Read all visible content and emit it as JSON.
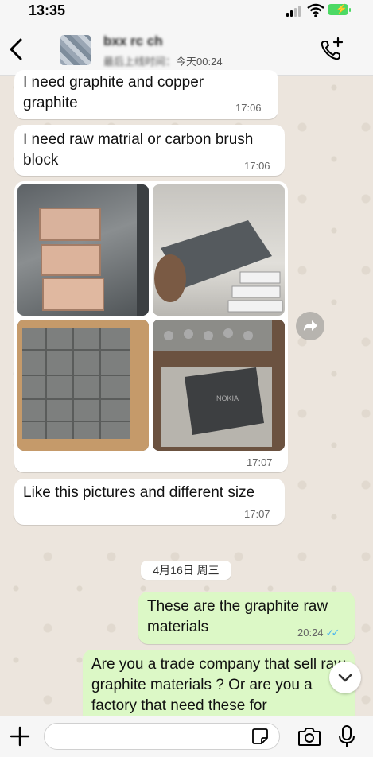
{
  "status": {
    "time": "13:35"
  },
  "header": {
    "contact_name": "bxx rc ch",
    "last_seen_prefix": "最后上线时间：",
    "last_seen_value": "今天00:24"
  },
  "messages": [
    {
      "text": "I need graphite and copper graphite",
      "time": "17:06",
      "direction": "in"
    },
    {
      "text": "I need raw matrial or carbon brush block",
      "time": "17:06",
      "direction": "in"
    },
    {
      "type": "photos",
      "count": 4,
      "time": "17:07",
      "direction": "in",
      "photo_labels": [
        "",
        "",
        "",
        "NOKIA"
      ]
    },
    {
      "text": "Like this pictures and different size",
      "time": "17:07",
      "direction": "in"
    },
    {
      "text": "These are the graphite raw materials",
      "time": "20:24",
      "direction": "out"
    },
    {
      "text": "Are you a trade company that sell raw graphite materials ? Or are you a factory that need these for",
      "direction": "out"
    }
  ],
  "date_separator": "4月16日 周三",
  "input": {
    "placeholder": ""
  },
  "colors": {
    "incoming": "#ffffff",
    "outgoing": "#dcf8c6",
    "read_ticks": "#4fb6ec",
    "background": "#ece5dd"
  },
  "icons": [
    "back-chevron-icon",
    "add-call-icon",
    "forward-icon",
    "chevron-down-icon",
    "plus-icon",
    "sticker-icon",
    "camera-icon",
    "mic-icon"
  ]
}
